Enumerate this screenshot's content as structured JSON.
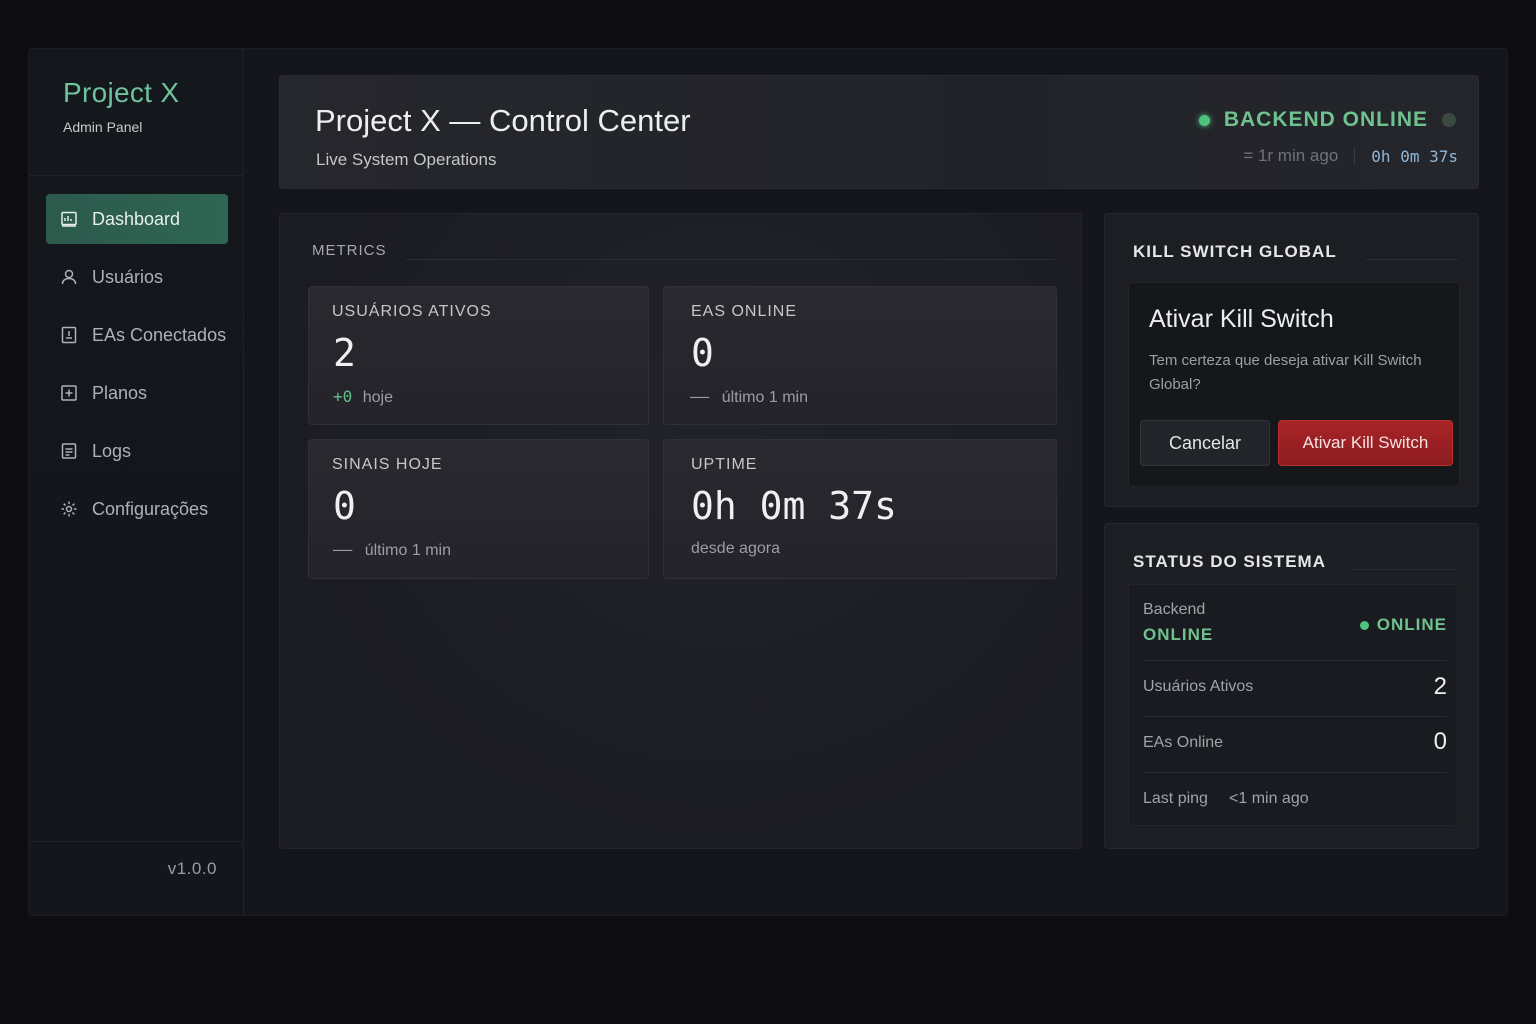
{
  "sidebar": {
    "brand": "Project X",
    "subtitle": "Admin Panel",
    "items": [
      {
        "label": "Dashboard",
        "icon": "dashboard-icon",
        "active": true
      },
      {
        "label": "Usuários",
        "icon": "user-icon"
      },
      {
        "label": "EAs Conectados",
        "icon": "ea-icon"
      },
      {
        "label": "Planos",
        "icon": "plus-square-icon"
      },
      {
        "label": "Logs",
        "icon": "file-icon"
      },
      {
        "label": "Configurações",
        "icon": "gear-icon"
      }
    ],
    "version": "v1.0.0"
  },
  "header": {
    "title": "Project X — Control Center",
    "subtitle": "Live System Operations",
    "status": "BACKEND ONLINE",
    "last_update": "= 1r min ago",
    "uptime": "0h 0m 37s"
  },
  "metrics": {
    "label": "METRICS",
    "cards": [
      {
        "label": "USUÁRIOS ATIVOS",
        "value": "2",
        "delta": "+0",
        "foot": "hoje"
      },
      {
        "label": "EAS ONLINE",
        "value": "0",
        "delta": "——",
        "foot": "último 1 min"
      },
      {
        "label": "SINAIS HOJE",
        "value": "0",
        "delta": "——",
        "foot": "último 1 min"
      },
      {
        "label": "UPTIME",
        "value": "0h 0m 37s",
        "foot": "desde agora"
      }
    ]
  },
  "kill_switch": {
    "title": "KILL SWITCH GLOBAL",
    "dialog_title": "Ativar Kill Switch",
    "dialog_text": "Tem certeza que deseja ativar Kill Switch Global?",
    "cancel_label": "Cancelar",
    "confirm_label": "Ativar Kill Switch"
  },
  "system_status": {
    "title": "STATUS DO SISTEMA",
    "backend_label": "Backend",
    "backend_value": "ONLINE",
    "backend_badge": "ONLINE",
    "active_users_label": "Usuários Ativos",
    "active_users_value": "2",
    "eas_online_label": "EAs Online",
    "eas_online_value": "0",
    "last_ping_label": "Last ping",
    "last_ping_value": "<1 min ago"
  },
  "colors": {
    "accent_green": "#6fc29c",
    "status_green": "#4fc27b",
    "danger_red": "#a82427",
    "background": "#15161b"
  }
}
